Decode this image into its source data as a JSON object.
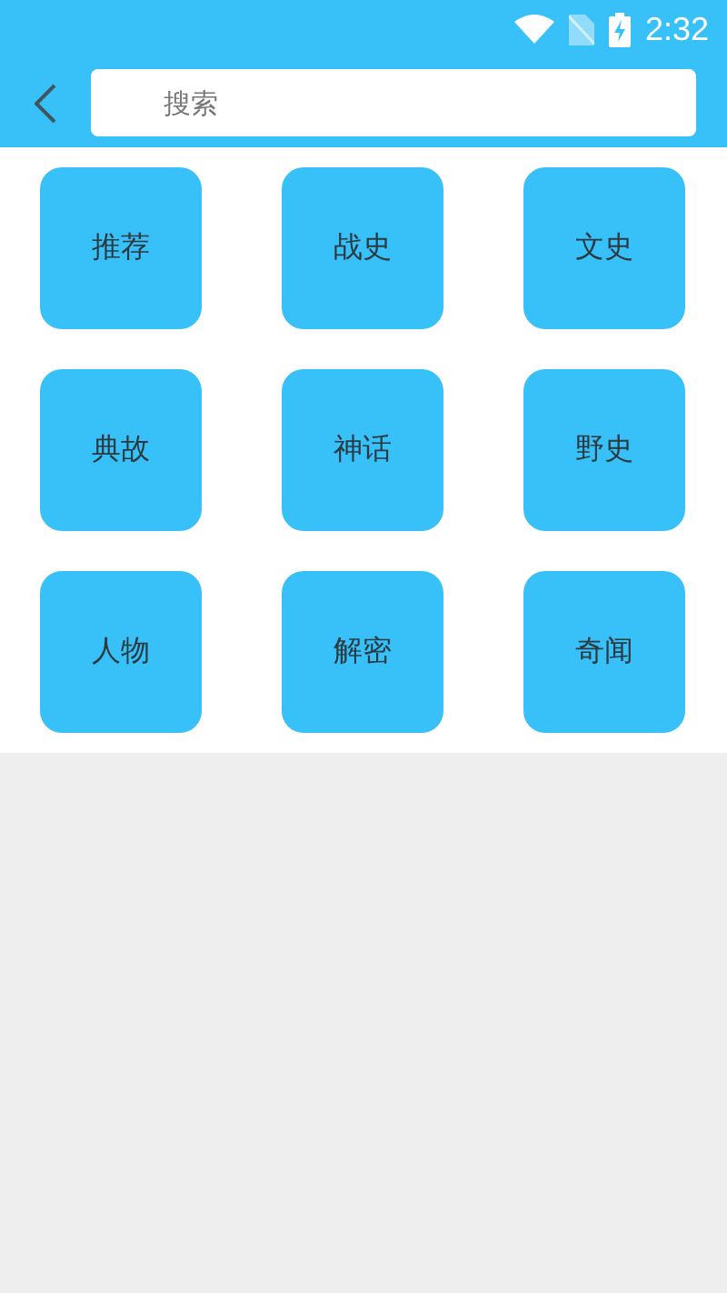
{
  "status_bar": {
    "time": "2:32"
  },
  "search": {
    "placeholder": "搜索"
  },
  "categories": [
    {
      "label": "推荐"
    },
    {
      "label": "战史"
    },
    {
      "label": "文史"
    },
    {
      "label": "典故"
    },
    {
      "label": "神话"
    },
    {
      "label": "野史"
    },
    {
      "label": "人物"
    },
    {
      "label": "解密"
    },
    {
      "label": "奇闻"
    }
  ]
}
